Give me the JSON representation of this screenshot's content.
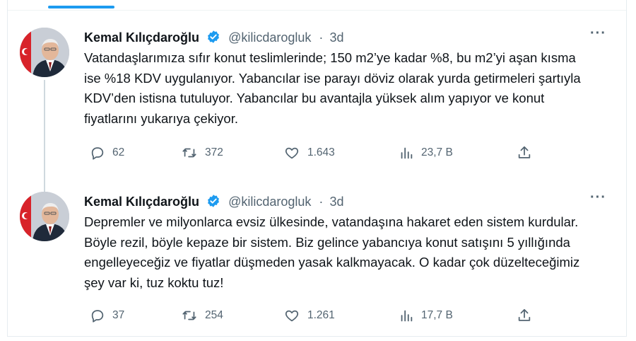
{
  "tweets": [
    {
      "author": "Kemal Kılıçdaroğlu",
      "handle": "@kilicdarogluk",
      "time": "3d",
      "text": "Vatandaşlarımıza sıfır konut teslimlerinde; 150 m2’ye kadar %8, bu m2’yi aşan kısma ise %18 KDV uygulanıyor. Yabancılar ise parayı döviz olarak yurda getirmeleri şartıyla KDV’den istisna tutuluyor. Yabancılar bu avantajla yüksek alım yapıyor ve konut fiyatlarını yukarıya çekiyor.",
      "replies": "62",
      "retweets": "372",
      "likes": "1.643",
      "views": "23,7 B"
    },
    {
      "author": "Kemal Kılıçdaroğlu",
      "handle": "@kilicdarogluk",
      "time": "3d",
      "text": "Depremler ve milyonlarca evsiz ülkesinde, vatandaşına hakaret eden sistem kurdular. Böyle rezil, böyle kepaze bir sistem. Biz gelince yabancıya konut satışını 5 yıllığında engelleyeceğiz ve fiyatlar düşmeden yasak kalkmayacak. O kadar çok düzelteceğimiz şey var ki, tuz koktu tuz!",
      "replies": "37",
      "retweets": "254",
      "likes": "1.261",
      "views": "17,7 B"
    }
  ],
  "icons": {
    "reply": "reply-icon",
    "retweet": "retweet-icon",
    "like": "heart-icon",
    "views": "views-icon",
    "share": "share-icon",
    "verified": "verified-badge-icon",
    "more": "more-icon"
  },
  "colors": {
    "accent": "#1d9bf0",
    "text": "#0f1419",
    "secondary": "#536471"
  }
}
